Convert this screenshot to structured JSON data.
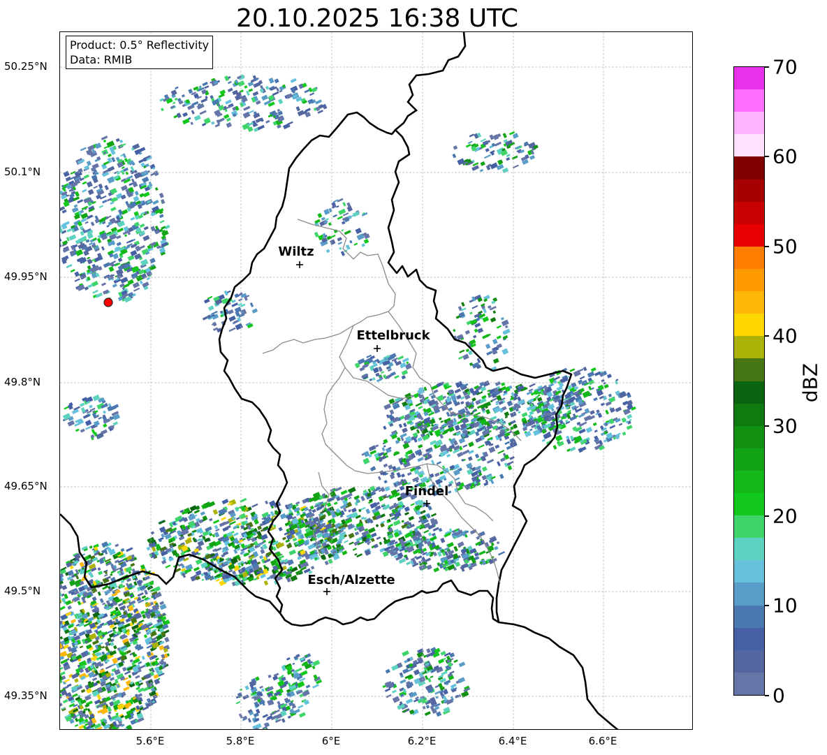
{
  "title": "20.10.2025 16:38 UTC",
  "info": {
    "product": "Product: 0.5° Reflectivity",
    "data": "Data: RMIB"
  },
  "axes": {
    "lat_ticks": [
      "50.25°N",
      "50.1°N",
      "49.95°N",
      "49.8°N",
      "49.65°N",
      "49.5°N",
      "49.35°N"
    ],
    "lon_ticks": [
      "5.6°E",
      "5.8°E",
      "6°E",
      "6.2°E",
      "6.4°E",
      "6.6°E"
    ],
    "grid": true
  },
  "cities": [
    {
      "name": "Wiltz"
    },
    {
      "name": "Ettelbruck"
    },
    {
      "name": "Findel"
    },
    {
      "name": "Esch/Alzette"
    }
  ],
  "radar_site_color": "#ff0000",
  "colorbar": {
    "label": "dBZ",
    "tick_labels": [
      "0",
      "10",
      "20",
      "30",
      "40",
      "50",
      "60",
      "70"
    ],
    "colors": [
      "#6575a8",
      "#5466a0",
      "#4560a5",
      "#4a78b0",
      "#5a9cc8",
      "#66c2dc",
      "#5ed2c0",
      "#3fd56a",
      "#13c81d",
      "#14b818",
      "#12a414",
      "#119012",
      "#0e7a10",
      "#0a6410",
      "#467514",
      "#aab306",
      "#ffd700",
      "#ffb80a",
      "#ff9a00",
      "#ff7e00",
      "#e60000",
      "#c80000",
      "#a60000",
      "#7e0000",
      "#ffe1ff",
      "#ffb4ff",
      "#ff6eff",
      "#e632ea"
    ]
  }
}
